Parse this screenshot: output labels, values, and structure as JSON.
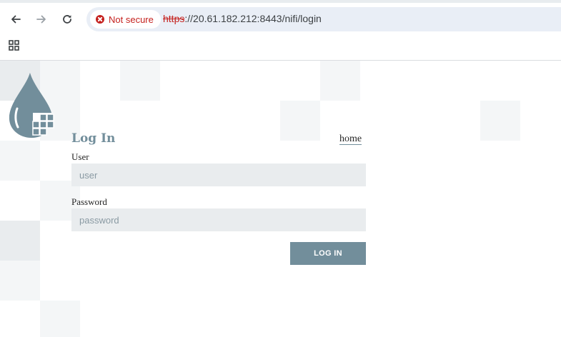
{
  "browser": {
    "security_label": "Not secure",
    "url_scheme": "https",
    "url_rest": "://20.61.182.212:8443/nifi/login",
    "icons": {
      "back": "back-arrow-icon",
      "forward": "forward-arrow-icon",
      "reload": "reload-icon",
      "security": "warning-icon",
      "apps": "apps-grid-icon"
    },
    "colors": {
      "warning": "#c5221f",
      "omnibox": "#e9eef6"
    }
  },
  "login": {
    "title": "Log In",
    "home_link": "home",
    "user_label": "User",
    "user_placeholder": "user",
    "password_label": "Password",
    "password_placeholder": "password",
    "submit_label": "LOG IN"
  },
  "theme": {
    "accent": "#728e9b",
    "input_bg": "#e9ecee",
    "tile": "#f4f6f7"
  }
}
